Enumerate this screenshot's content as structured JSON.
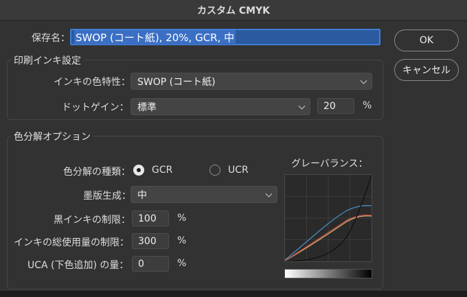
{
  "window": {
    "title": "カスタム CMYK"
  },
  "name": {
    "label": "保存名：",
    "value": "SWOP (コート紙), 20%, GCR, 中"
  },
  "buttons": {
    "ok": "OK",
    "cancel": "キャンセル"
  },
  "ink_settings": {
    "title": "印刷インキ設定",
    "ink_colors_label": "インキの色特性：",
    "ink_colors_value": "SWOP (コート紙)",
    "dot_gain_label": "ドットゲイン：",
    "dot_gain_value": "標準",
    "dot_gain_amount": "20",
    "percent": "%"
  },
  "separation": {
    "title": "色分解オプション",
    "type_label": "色分解の種類：",
    "gcr": "GCR",
    "ucr": "UCR",
    "selected": "GCR",
    "black_gen_label": "墨版生成：",
    "black_gen_value": "中",
    "black_limit_label": "黒インキの制限：",
    "black_limit_value": "100",
    "total_limit_label": "インキの総使用量の制限：",
    "total_limit_value": "300",
    "uca_label": "UCA (下色追加) の量：",
    "uca_value": "0",
    "percent": "%",
    "gray_balance_label": "グレーバランス："
  },
  "colors": {
    "cyan_curve": "#4a8fc0",
    "magenta_curve": "#c8504a",
    "yellow_curve": "#d8b070",
    "black_curve": "#111111"
  }
}
